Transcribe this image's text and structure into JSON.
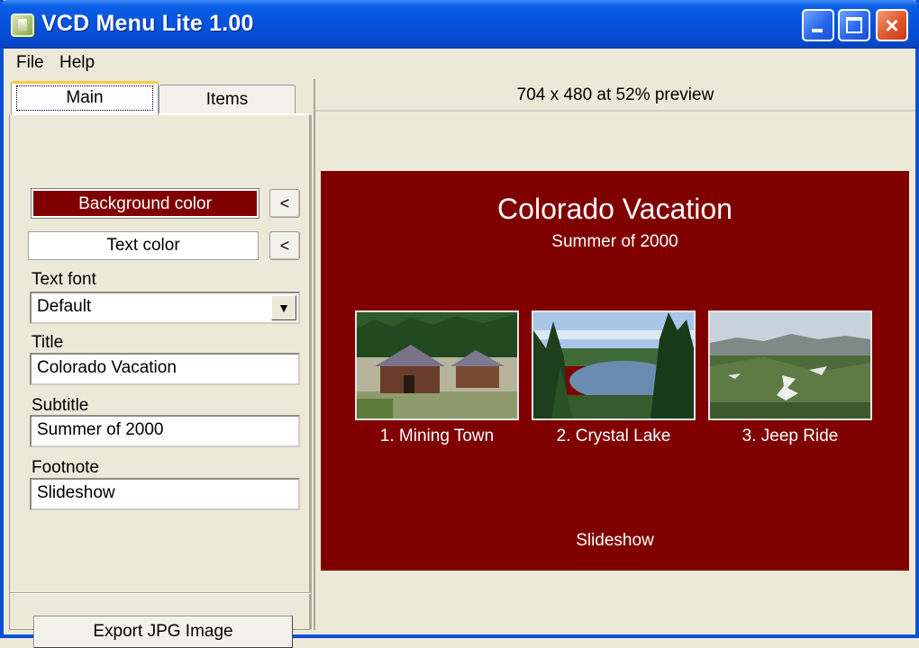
{
  "window": {
    "title": "VCD Menu Lite 1.00"
  },
  "menubar": {
    "file": "File",
    "help": "Help"
  },
  "tabs": {
    "main": "Main",
    "items": "Items"
  },
  "main_tab": {
    "background_color_label": "Background color",
    "background_color_value": "#800000",
    "text_color_label": "Text color",
    "text_color_value": "#ffffff",
    "pick_arrow": "<",
    "text_font_label": "Text font",
    "text_font_value": "Default",
    "title_label": "Title",
    "title_value": "Colorado Vacation",
    "subtitle_label": "Subtitle",
    "subtitle_value": "Summer of 2000",
    "footnote_label": "Footnote",
    "footnote_value": "Slideshow",
    "export_button": "Export JPG Image"
  },
  "preview": {
    "header": "704 x 480 at 52% preview",
    "title": "Colorado Vacation",
    "subtitle": "Summer of 2000",
    "items": [
      {
        "caption": "1. Mining Town"
      },
      {
        "caption": "2. Crystal Lake"
      },
      {
        "caption": "3. Jeep Ride"
      }
    ],
    "footnote": "Slideshow"
  }
}
